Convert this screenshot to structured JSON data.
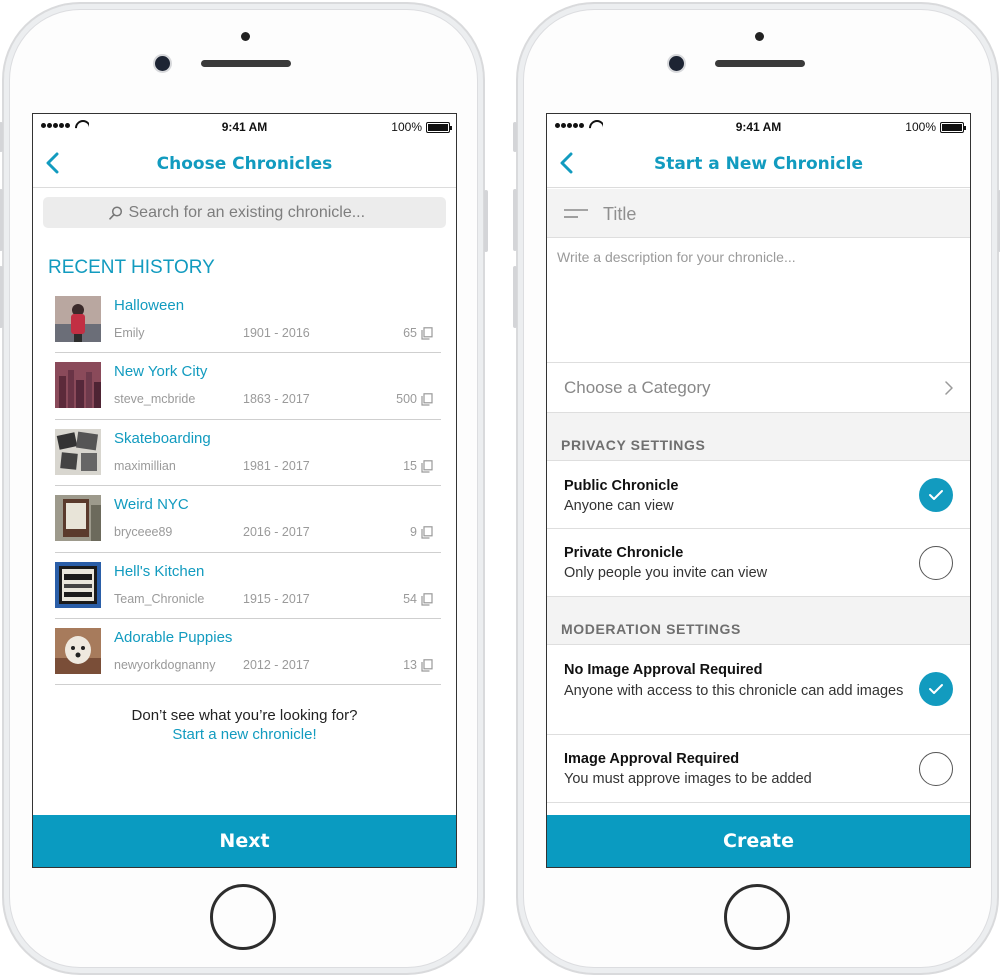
{
  "status_bar": {
    "time": "9:41 AM",
    "battery": "100%"
  },
  "left": {
    "nav_title": "Choose Chronicles",
    "search_placeholder": "Search for an existing chronicle...",
    "section_title": "RECENT HISTORY",
    "items": [
      {
        "title": "Halloween",
        "user": "Emily",
        "years": "1901 - 2016",
        "count": "65"
      },
      {
        "title": "New York City",
        "user": "steve_mcbride",
        "years": "1863 - 2017",
        "count": "500"
      },
      {
        "title": "Skateboarding",
        "user": "maximillian",
        "years": "1981 - 2017",
        "count": "15"
      },
      {
        "title": "Weird NYC",
        "user": "bryceee89",
        "years": "2016 - 2017",
        "count": "9"
      },
      {
        "title": "Hell's Kitchen",
        "user": "Team_Chronicle",
        "years": "1915 - 2017",
        "count": "54"
      },
      {
        "title": "Adorable Puppies",
        "user": "newyorkdognanny",
        "years": "2012 - 2017",
        "count": "13"
      }
    ],
    "footer_question": "Don’t see what you’re looking for?",
    "footer_link": "Start a new chronicle!",
    "next_label": "Next"
  },
  "right": {
    "nav_title": "Start a New Chronicle",
    "title_placeholder": "Title",
    "description_placeholder": "Write a description for your chronicle...",
    "category_label": "Choose a Category",
    "privacy_header": "PRIVACY SETTINGS",
    "privacy_options": [
      {
        "title": "Public Chronicle",
        "subtitle": "Anyone can view",
        "selected": true
      },
      {
        "title": "Private Chronicle",
        "subtitle": "Only people you invite can view",
        "selected": false
      }
    ],
    "moderation_header": "MODERATION SETTINGS",
    "moderation_options": [
      {
        "title": "No Image Approval Required",
        "subtitle": "Anyone with access to this chronicle can add images",
        "selected": true
      },
      {
        "title": "Image Approval Required",
        "subtitle": "You must approve images to be added",
        "selected": false
      }
    ],
    "create_label": "Create"
  },
  "colors": {
    "accent": "#129bbf",
    "button": "#0a9bc1"
  }
}
